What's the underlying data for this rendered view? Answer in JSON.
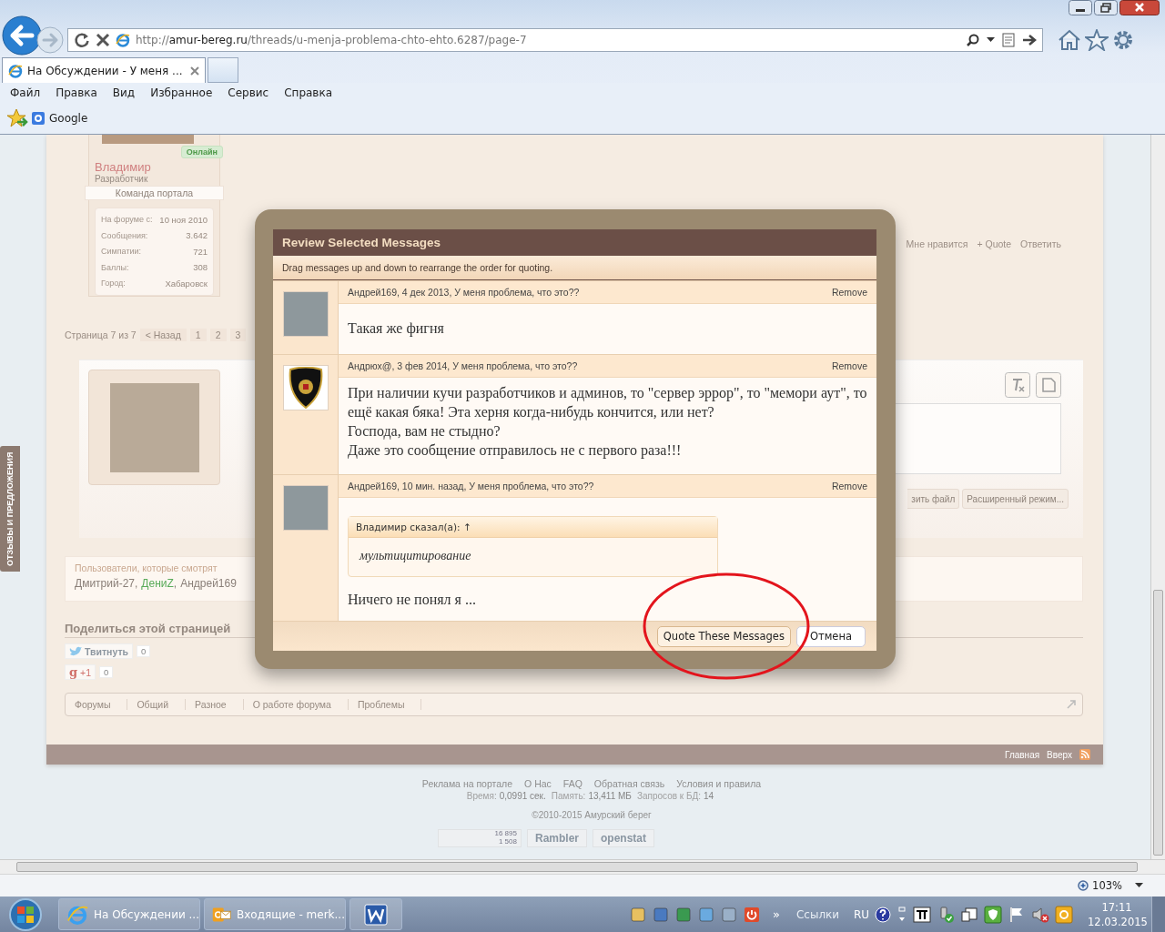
{
  "browser": {
    "address": {
      "scheme": "http://",
      "host": "amur-bereg.ru",
      "path": "/threads/u-menja-problema-chto-ehto.6287/page-7"
    },
    "tabs": [
      {
        "title": "На Обсуждении - У меня ...",
        "selected": true
      }
    ],
    "menu": [
      "Файл",
      "Правка",
      "Вид",
      "Избранное",
      "Сервис",
      "Справка"
    ],
    "favorites": [
      "Google"
    ]
  },
  "page": {
    "feedback_tab": "ОТЗЫВЫ И ПРЕДЛОЖЕНИЯ",
    "poster": {
      "status": "Онлайн",
      "name": "Владимир",
      "role": "Разработчик",
      "ribbon": "Команда портала",
      "stats": [
        {
          "label": "На форуме с:",
          "value": "10 ноя 2010"
        },
        {
          "label": "Сообщения:",
          "value": "3.642"
        },
        {
          "label": "Симпатии:",
          "value": "721"
        },
        {
          "label": "Баллы:",
          "value": "308"
        },
        {
          "label": "Город:",
          "value": "Хабаровск"
        }
      ]
    },
    "post_actions": [
      "Мне нравится",
      "+ Quote",
      "Ответить"
    ],
    "pagination": {
      "label": "Страница 7 из 7",
      "prev": "< Назад",
      "pages": [
        "1",
        "2",
        "3"
      ]
    },
    "editor": {
      "buttons": [
        "зить файл",
        "Расширенный режим..."
      ]
    },
    "viewers": {
      "title": "Пользователи, которые смотрят",
      "separator": ",",
      "users": [
        {
          "name": "Дмитрий-27",
          "color": "#8a7f78"
        },
        {
          "name": "ДениZ",
          "color": "#5aab5a"
        },
        {
          "name": "Андрей169",
          "color": "#8a7f78"
        }
      ]
    },
    "share": {
      "title": "Поделиться этой страницей",
      "buttons": [
        {
          "kind": "tweet",
          "label": "Твитнуть",
          "count": "0"
        },
        {
          "kind": "gplus",
          "logo": "g",
          "label": "+1",
          "count": "0"
        }
      ]
    },
    "breadcrumb": [
      "Форумы",
      "Общий",
      "Разное",
      "О работе форума",
      "Проблемы"
    ],
    "footer_nav": [
      "Главная",
      "Вверх"
    ]
  },
  "site_footer": {
    "links": [
      "Реклама на портале",
      "О Нас",
      "FAQ",
      "Обратная связь",
      "Условия и правила"
    ],
    "stats": [
      {
        "label": "Время:",
        "value": "0,0991 сек."
      },
      {
        "label": "Память:",
        "value": "13,411 МБ"
      },
      {
        "label": "Запросов к БД:",
        "value": "14"
      }
    ],
    "copyright": "©2010-2015 Амурский берег",
    "counters": [
      {
        "kind": "stats",
        "lines": [
          "16 895",
          "1 508"
        ]
      },
      {
        "kind": "logo",
        "label": "Rambler"
      },
      {
        "kind": "logo",
        "label": "openstat"
      }
    ]
  },
  "modal": {
    "title": "Review Selected Messages",
    "hint": "Drag messages up and down to rearrange the order for quoting.",
    "messages": [
      {
        "kind": "photo",
        "header": "Андрей169, 4 дек 2013, У меня проблема, что это??",
        "remove": "Remove",
        "body": [
          "Такая же фигня"
        ]
      },
      {
        "kind": "emblem",
        "header": "Андрюх@, 3 фев 2014, У меня проблема, что это??",
        "remove": "Remove",
        "body": [
          "При наличии кучи разработчиков и админов, то \"сервер эррор\", то \"мемори аут\", то ещё какая бяка! Эта херня когда-нибудь кончится, или нет?",
          "Господа, вам не стыдно?",
          "Даже это сообщение отправилось не с первого раза!!!"
        ]
      },
      {
        "kind": "photo",
        "header": "Андрей169, 10 мин. назад, У меня проблема, что это??",
        "remove": "Remove",
        "quote": {
          "author": "Владимир сказал(а): ↑",
          "text": "мультицитирование"
        },
        "body": [
          "Ничего не понял я ..."
        ]
      }
    ],
    "buttons": [
      {
        "kind": "primary",
        "label": "Quote These Messages"
      },
      {
        "kind": "secondary",
        "label": "Отмена"
      }
    ]
  },
  "status_bar": {
    "zoom": "103%"
  },
  "taskbar": {
    "windows": [
      {
        "kind": "ie",
        "label": "На Обсуждении ..."
      },
      {
        "kind": "outlook",
        "label": "Входящие - merk..."
      },
      {
        "kind": "word"
      }
    ],
    "more": "»",
    "links_label": "Ссылки",
    "language": "RU",
    "time": "17:11",
    "date": "12.03.2015"
  }
}
